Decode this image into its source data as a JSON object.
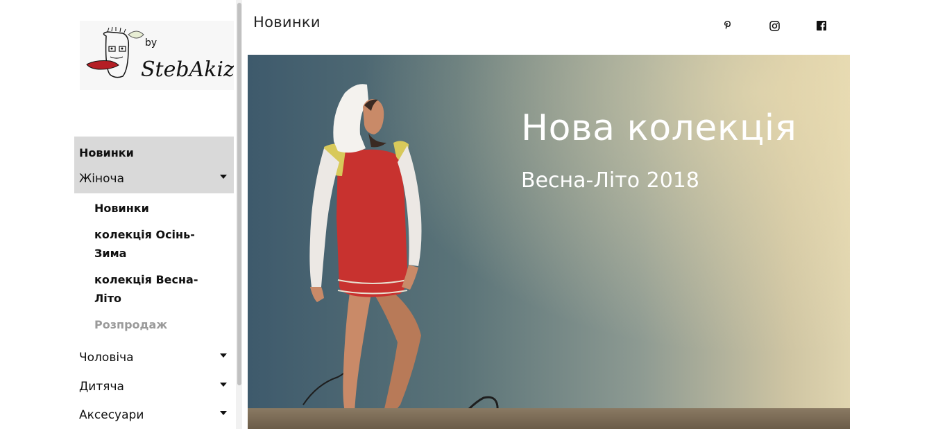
{
  "brand": {
    "logo_text": "StebAkizm",
    "logo_by": "by"
  },
  "header": {
    "title": "Новинки"
  },
  "social": [
    {
      "name": "pinterest-icon"
    },
    {
      "name": "instagram-icon"
    },
    {
      "name": "facebook-icon"
    }
  ],
  "sidebar": {
    "items": [
      {
        "label": "Новинки"
      },
      {
        "label": "Жіноча"
      },
      {
        "label": "Чоловіча"
      },
      {
        "label": "Дитяча"
      },
      {
        "label": "Аксесуари"
      }
    ],
    "submenu": [
      {
        "label": "Новинки"
      },
      {
        "label": "колекція Осінь-Зима"
      },
      {
        "label": "колекція Весна-Літо"
      },
      {
        "label": "Розпродаж"
      }
    ]
  },
  "hero": {
    "title": "Нова колекція",
    "subtitle": "Весна-Літо 2018"
  },
  "colors": {
    "menu_active_bg": "#d9d9d9",
    "muted_text": "#9a9a9a",
    "hero_text": "#ffffff",
    "dress_red": "#c8322f"
  }
}
